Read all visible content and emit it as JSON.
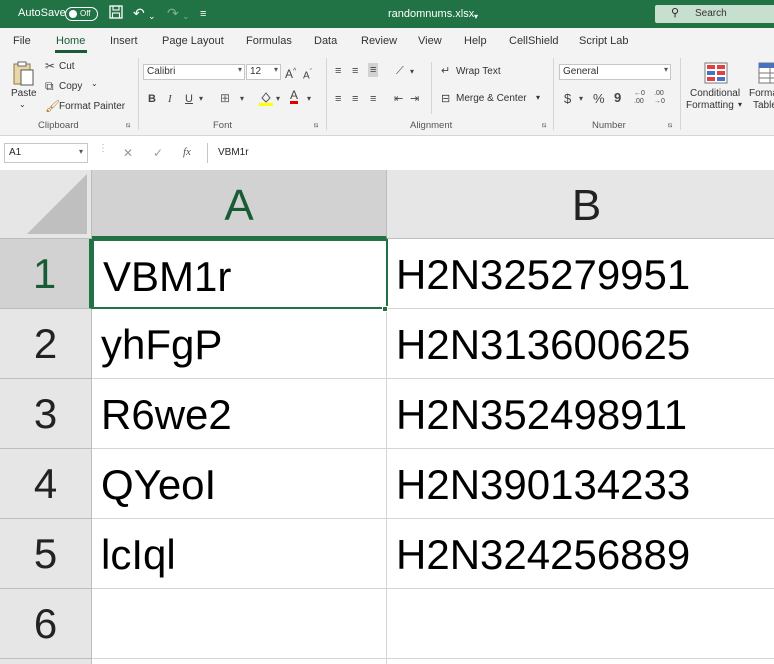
{
  "titlebar": {
    "autosave_label": "AutoSave",
    "autosave_state": "Off",
    "filename": "randomnums.xlsx",
    "search_placeholder": "Search"
  },
  "tabs": [
    "File",
    "Home",
    "Insert",
    "Page Layout",
    "Formulas",
    "Data",
    "Review",
    "View",
    "Help",
    "CellShield",
    "Script Lab"
  ],
  "active_tab": "Home",
  "ribbon": {
    "clipboard": {
      "paste": "Paste",
      "cut": "Cut",
      "copy": "Copy",
      "format_painter": "Format Painter",
      "group_label": "Clipboard"
    },
    "font": {
      "family": "Calibri",
      "size": "12",
      "bold": "B",
      "italic": "I",
      "underline": "U",
      "font_color_letter": "A",
      "group_label": "Font"
    },
    "alignment": {
      "wrap_text": "Wrap Text",
      "merge_center": "Merge & Center",
      "group_label": "Alignment"
    },
    "number": {
      "format": "General",
      "currency": "$",
      "percent": "%",
      "comma": "9",
      "group_label": "Number"
    },
    "styles": {
      "conditional_formatting_line1": "Conditional",
      "conditional_formatting_line2": "Formatting",
      "format_table_line1": "Forma",
      "format_table_line2": "Table"
    }
  },
  "formula_bar": {
    "name_box": "A1",
    "fx": "fx",
    "content": "VBM1r"
  },
  "sheet": {
    "columns": [
      "A",
      "B"
    ],
    "selected_column": "A",
    "selected_row": "1",
    "active_cell": "A1",
    "rows": [
      {
        "row": "1",
        "A": "VBM1r",
        "B": "H2N325279951"
      },
      {
        "row": "2",
        "A": "yhFgP",
        "B": "H2N313600625"
      },
      {
        "row": "3",
        "A": "R6we2",
        "B": "H2N352498911"
      },
      {
        "row": "4",
        "A": "QYeoI",
        "B": "H2N390134233"
      },
      {
        "row": "5",
        "A": "lcIql",
        "B": "H2N324256889"
      },
      {
        "row": "6",
        "A": "",
        "B": ""
      }
    ]
  },
  "colors": {
    "excel_green": "#217346",
    "header_gray": "#e6e6e6",
    "selected_header": "#d2d2d2"
  }
}
